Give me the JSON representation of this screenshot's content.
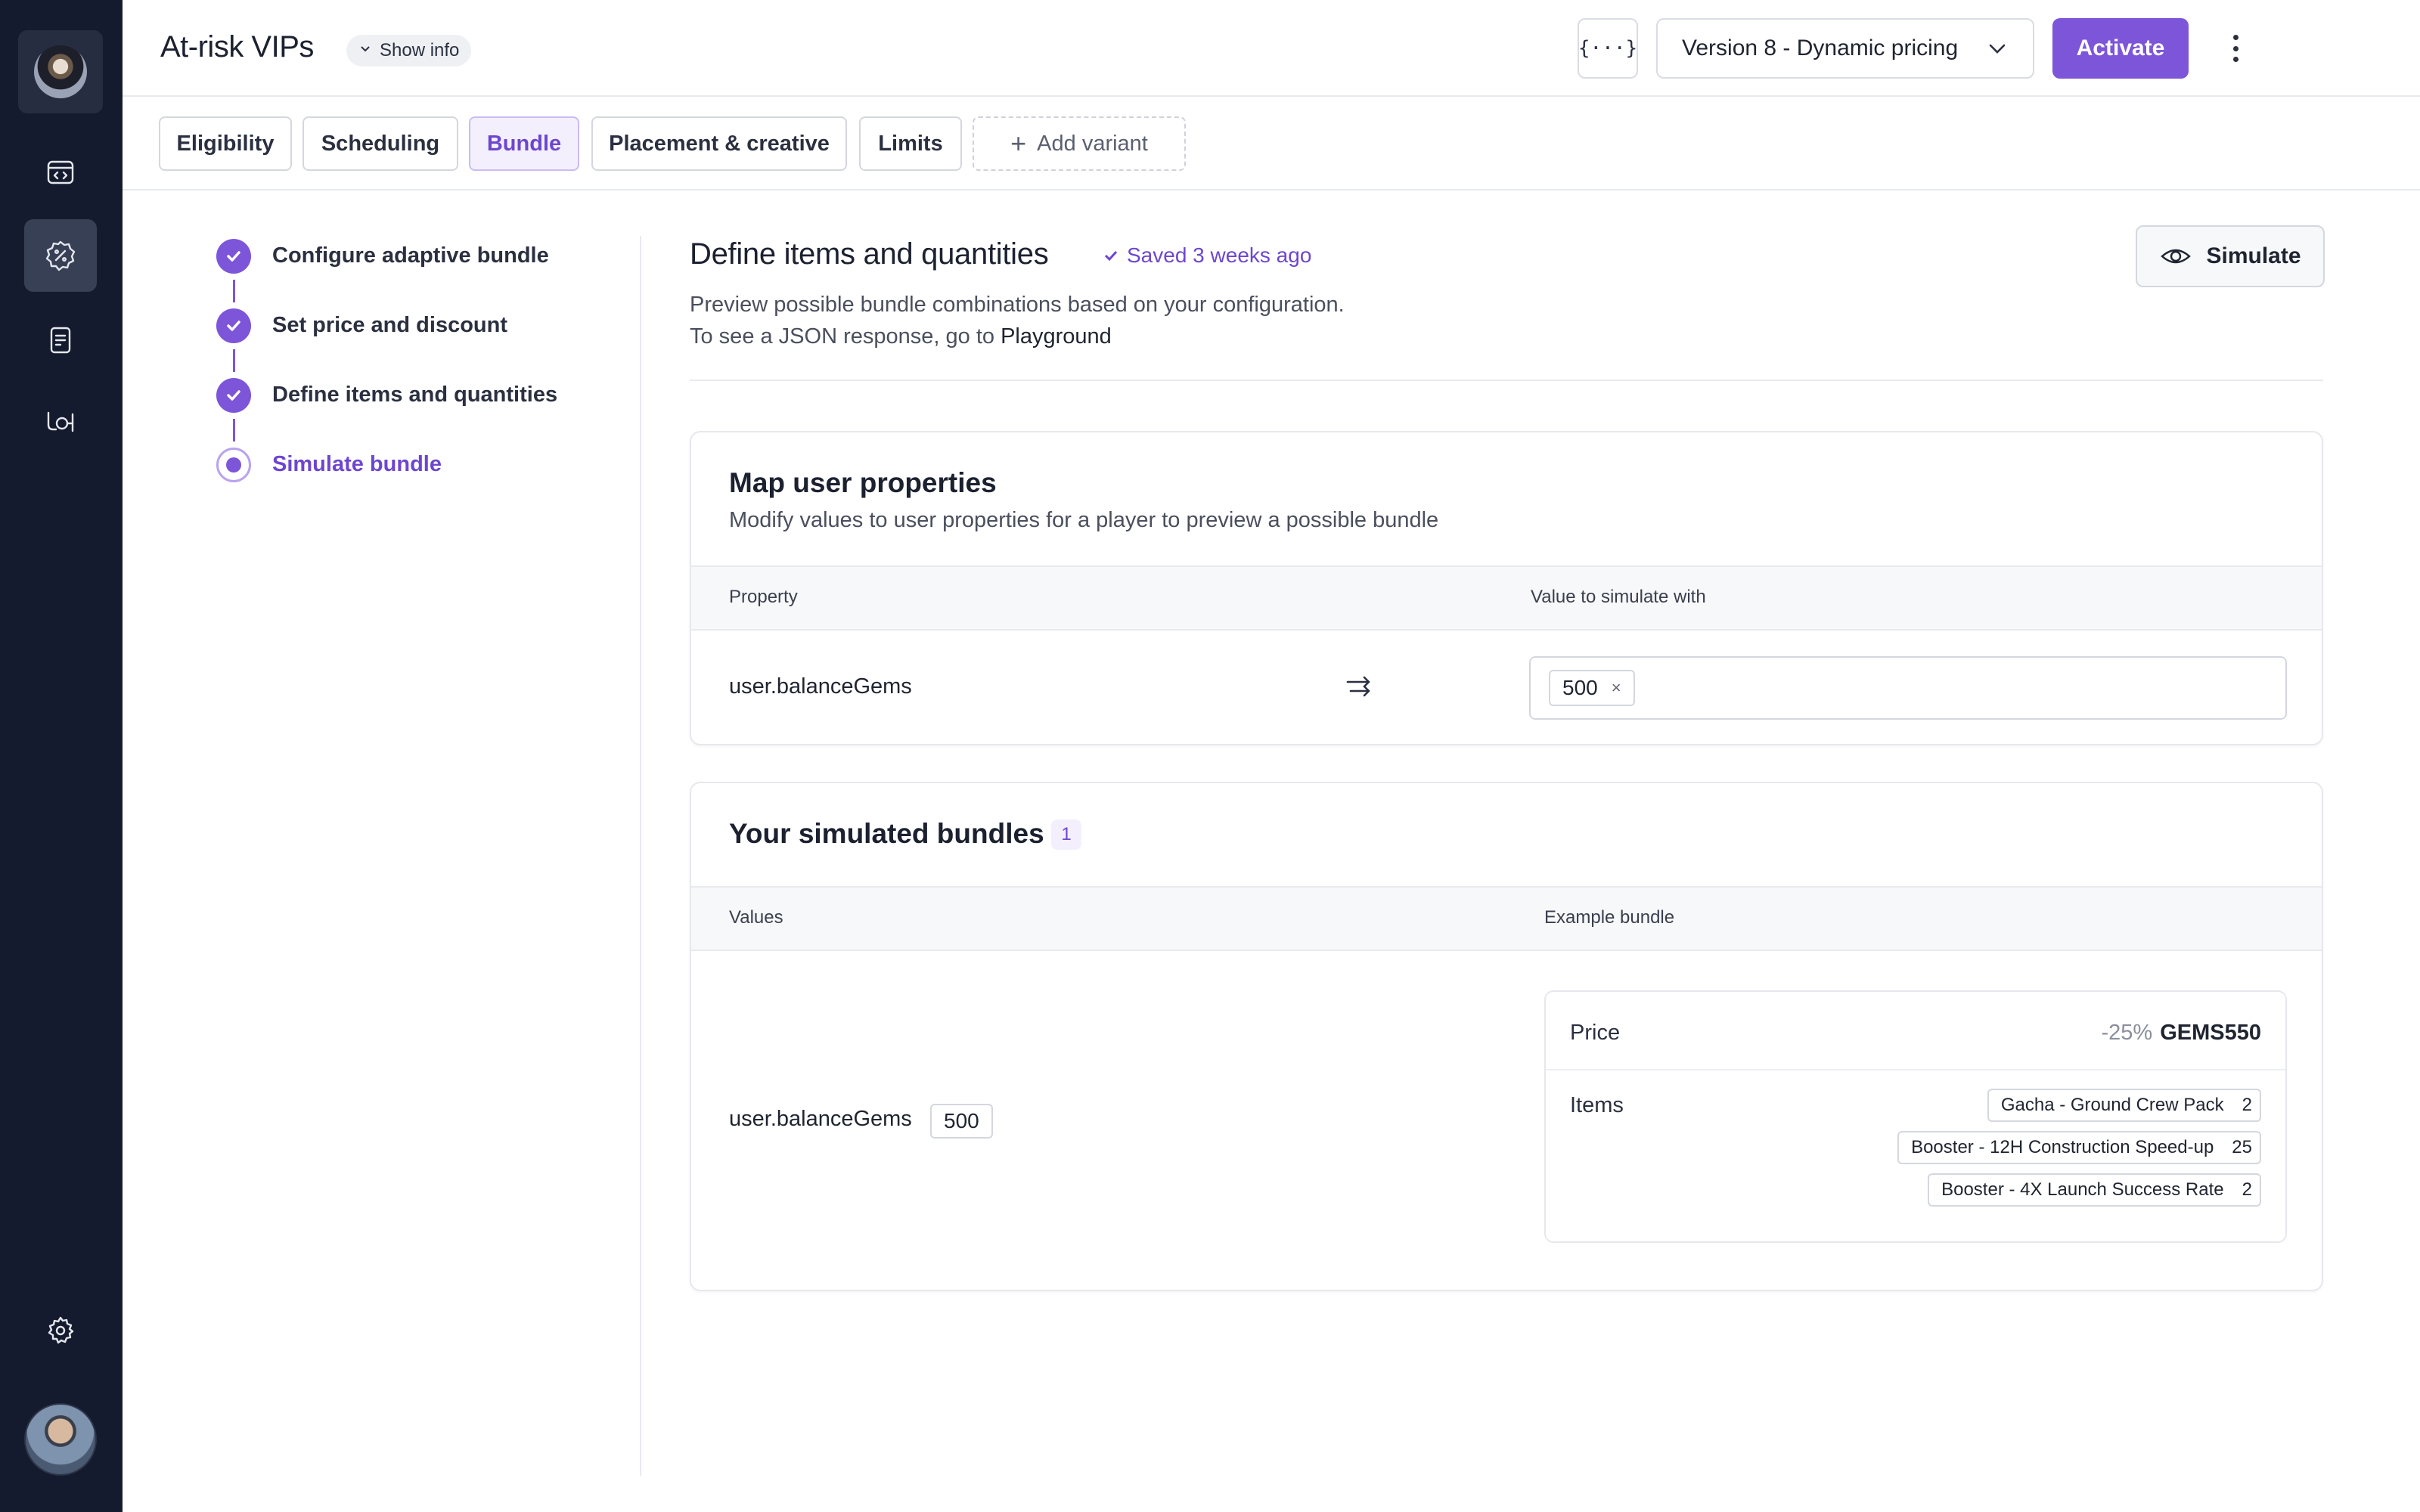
{
  "header": {
    "title": "At-risk VIPs",
    "show_info": "Show info",
    "code_icon_label": "{···}",
    "version": "Version 8 - Dynamic pricing",
    "activate": "Activate"
  },
  "tabs": [
    {
      "label": "Eligibility"
    },
    {
      "label": "Scheduling"
    },
    {
      "label": "Bundle"
    },
    {
      "label": "Placement & creative"
    },
    {
      "label": "Limits"
    },
    {
      "label": "Add variant"
    }
  ],
  "stepper": [
    {
      "label": "Configure adaptive bundle"
    },
    {
      "label": "Set price and discount"
    },
    {
      "label": "Define items and quantities"
    },
    {
      "label": "Simulate bundle"
    }
  ],
  "main": {
    "title": "Define items and quantities",
    "saved": "Saved 3 weeks ago",
    "simulate": "Simulate",
    "desc_line1": "Preview possible bundle combinations based on your configuration.",
    "desc_line2": "To see a JSON response, go to ",
    "desc_link": "Playground"
  },
  "map_card": {
    "title": "Map user properties",
    "subtitle": "Modify values to user properties for a player to preview a possible bundle",
    "col_property": "Property",
    "col_value": "Value to simulate with",
    "property": "user.balanceGems",
    "value": "500",
    "remove_glyph": "×"
  },
  "bundles_card": {
    "title": "Your simulated bundles",
    "count": "1",
    "col_values": "Values",
    "col_example": "Example bundle",
    "property": "user.balanceGems",
    "value": "500",
    "price_label": "Price",
    "discount": "-25%",
    "price": "GEMS550",
    "items_label": "Items",
    "items": [
      {
        "name": "Gacha - Ground Crew Pack",
        "qty": "2"
      },
      {
        "name": "Booster - 12H Construction Speed-up",
        "qty": "25"
      },
      {
        "name": "Booster - 4X Launch Success Rate",
        "qty": "2"
      }
    ]
  },
  "colors": {
    "accent": "#7d55d9",
    "sidebar": "#151b2e"
  }
}
